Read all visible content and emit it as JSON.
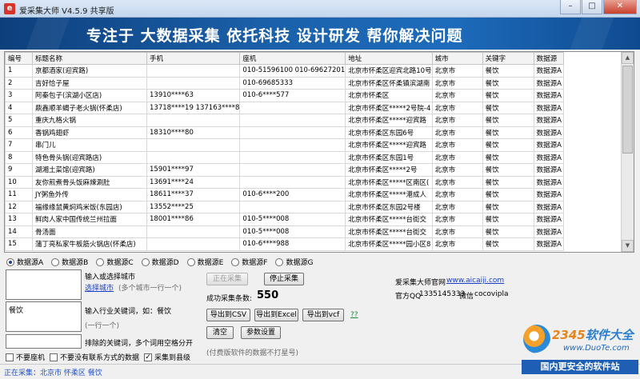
{
  "window": {
    "title": "爱采集大师 V4.5.9 共享版",
    "icon_letter": "e",
    "controls": [
      "minimize",
      "maximize",
      "close"
    ]
  },
  "banner": {
    "slogan": "专注于 大数据采集 依托科技 设计研发 帮你解决问题"
  },
  "grid": {
    "columns": [
      "编号",
      "标题名称",
      "手机",
      "座机",
      "地址",
      "城市",
      "关键字",
      "数据源"
    ],
    "rows": [
      [
        "1",
        "京都酒家(迎宾路)",
        "",
        "010-51596100 010-69627201",
        "北京市怀柔区迎宾北路10号",
        "北京市",
        "餐饮",
        "数据源A"
      ],
      [
        "2",
        "吉好恰子屋",
        "",
        "010-69685333",
        "北京市怀柔区怀柔镇滨湖南",
        "北京市",
        "餐饮",
        "数据源A"
      ],
      [
        "3",
        "阿秦包子(滨湖小区店)",
        "13910****63",
        "010-6****577",
        "北京市怀柔区",
        "北京市",
        "餐饮",
        "数据源A"
      ],
      [
        "4",
        "鼎鑫顺羊蝎子老火锅(怀柔店)",
        "13718****19 137163****8",
        "",
        "北京市怀柔区*****2号院-4",
        "北京市",
        "餐饮",
        "数据源A"
      ],
      [
        "5",
        "重庆九格火锅",
        "",
        "",
        "北京市怀柔区*****迎宾路",
        "北京市",
        "餐饮",
        "数据源A"
      ],
      [
        "6",
        "香锅鸡翅虾",
        "18310****80",
        "",
        "北京市怀柔区东园6号",
        "北京市",
        "餐饮",
        "数据源A"
      ],
      [
        "7",
        "串门儿",
        "",
        "",
        "北京市怀柔区*****迎宾路",
        "北京市",
        "餐饮",
        "数据源A"
      ],
      [
        "8",
        "特色骨头锅(迎宾路店)",
        "",
        "",
        "北京市怀柔区东园1号",
        "北京市",
        "餐饮",
        "数据源A"
      ],
      [
        "9",
        "湖湘土菜馆(迎宾路)",
        "15901****97",
        "",
        "北京市怀柔区*****2号",
        "北京市",
        "餐饮",
        "数据源A"
      ],
      [
        "10",
        "友你煎煮骨头饭麻辣涮肚",
        "13691****24",
        "",
        "北京市怀柔区*****区南区(",
        "北京市",
        "餐饮",
        "数据源A"
      ],
      [
        "11",
        "JY粥鱼外传",
        "18611****37",
        "010-6****200",
        "北京市怀柔区*****港成人",
        "北京市",
        "餐饮",
        "数据源A"
      ],
      [
        "12",
        "福缘缘鼠黄焖鸡米饭(东园店)",
        "13552****25",
        "",
        "北京市怀柔区东园2号楼",
        "北京市",
        "餐饮",
        "数据源A"
      ],
      [
        "13",
        "鲜肉人家中国传统兰州拉面",
        "18001****86",
        "010-5****008",
        "北京市怀柔区*****台街交",
        "北京市",
        "餐饮",
        "数据源A"
      ],
      [
        "14",
        "骨汤面",
        "",
        "010-5****008",
        "北京市怀柔区*****台街交",
        "北京市",
        "餐饮",
        "数据源A"
      ],
      [
        "15",
        "蒲丁亮私家牛板筋火锅店(怀柔店)",
        "",
        "010-6****988",
        "北京市怀柔区*****园小区8",
        "北京市",
        "餐饮",
        "数据源A"
      ]
    ]
  },
  "sources": {
    "options": [
      "数据源A",
      "数据源B",
      "数据源C",
      "数据源D",
      "数据源E",
      "数据源F",
      "数据源G"
    ],
    "selected_index": 0
  },
  "city": {
    "prompt": "输入或选择城市",
    "select_link": "选择城市",
    "hint": "(多个城市一行一个)",
    "value": ""
  },
  "keyword": {
    "prompt": "输入行业关键词，如：餐饮",
    "hint": "(一行一个)",
    "value": "餐饮",
    "note": "排除的关键词，多个词用空格分开"
  },
  "checks": {
    "no_phone": "不要座机",
    "no_contact": "不要没有联系方式的数据",
    "to_county": "采集到县级",
    "to_county_checked": true
  },
  "actions": {
    "collecting": "正在采集",
    "stop": "停止采集",
    "success_label": "成功采集条数:",
    "success_count": "550",
    "export_csv": "导出到CSV",
    "export_excel": "导出到Excel",
    "export_vcf": "导出到vcf",
    "help": "??",
    "clear": "清空",
    "settings": "参数设置",
    "paid_note": "(付费版软件的数据不打星号)"
  },
  "about": {
    "site_label": "爱采集大师官网",
    "site_url": "www.aicaiji.com",
    "qq_label": "官方QQ",
    "qq": "1335145333",
    "wechat_label": "微信",
    "wechat": "cocovipla"
  },
  "status": {
    "text": "正在采集：北京市 怀柔区 餐饮"
  },
  "watermark": {
    "logo_num": "2345",
    "logo_text": "软件大全",
    "url": "www.DuoTe.com",
    "tagline": "国内更安全的软件站"
  }
}
